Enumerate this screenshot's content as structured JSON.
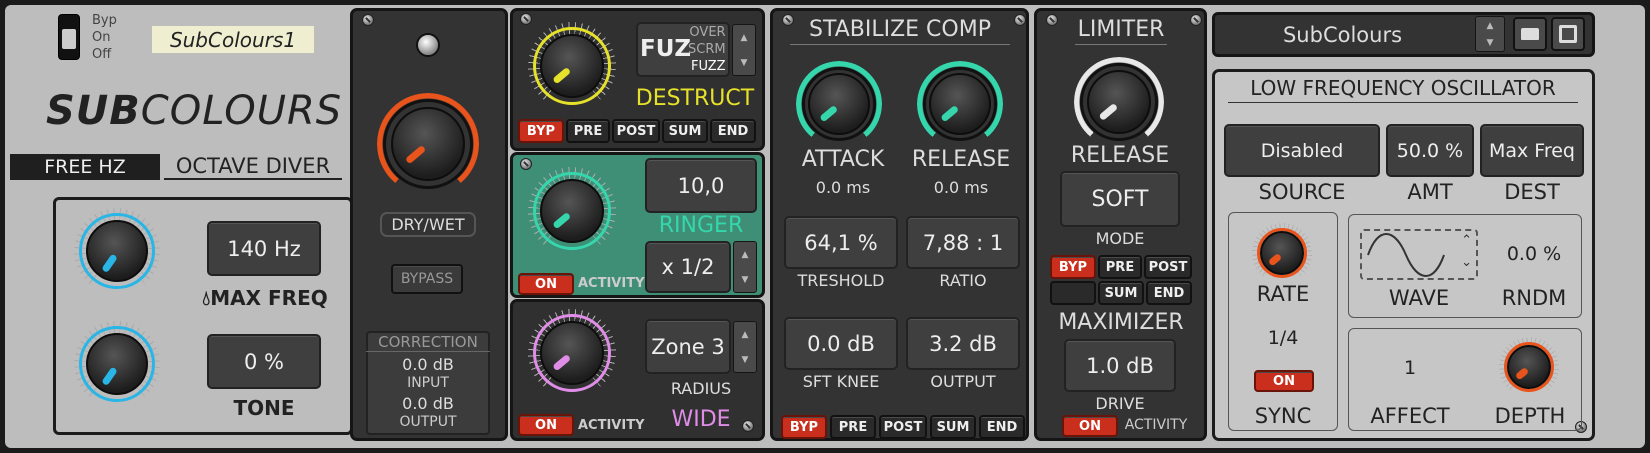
{
  "header": {
    "switch_labels": [
      "Byp",
      "On",
      "Off"
    ],
    "preset_tag": "SubColours1",
    "logo_bold": "SUB",
    "logo_light": "COLOURS",
    "mode_free": "FREE HZ",
    "mode_octave": "OCTAVE DIVER"
  },
  "lowband": {
    "max_freq_value": "140 Hz",
    "max_freq_label": "MAX FREQ",
    "tone_value": "0 %",
    "tone_label": "TONE"
  },
  "mix": {
    "drywet_label": "DRY/WET",
    "bypass_label": "BYPASS",
    "correction_title": "CORRECTION",
    "input_value": "0.0 dB",
    "input_label": "INPUT",
    "output_value": "0.0 dB",
    "output_label": "OUTPUT"
  },
  "destruct": {
    "algo_big": "FUZ",
    "algo_options": [
      "OVER",
      "SCRM",
      "FUZZ"
    ],
    "title": "DESTRUCT",
    "buttons": [
      "BYP",
      "PRE",
      "POST",
      "SUM",
      "END"
    ]
  },
  "ringer": {
    "value": "10,0",
    "title": "RINGER",
    "ratio": "x 1/2",
    "on_label": "ON",
    "activity_label": "ACTIVITY"
  },
  "wide": {
    "zone": "Zone 3",
    "radius_label": "RADIUS",
    "title": "WIDE",
    "on_label": "ON",
    "activity_label": "ACTIVITY"
  },
  "comp": {
    "title": "STABILIZE COMP",
    "attack_label": "ATTACK",
    "attack_value": "0.0 ms",
    "release_label": "RELEASE",
    "release_value": "0.0 ms",
    "threshold_value": "64,1 %",
    "threshold_label": "TRESHOLD",
    "ratio_value": "7,88 : 1",
    "ratio_label": "RATIO",
    "knee_value": "0.0 dB",
    "knee_label": "SFT KNEE",
    "output_value": "3.2 dB",
    "output_label": "OUTPUT",
    "buttons": [
      "BYP",
      "PRE",
      "POST",
      "SUM",
      "END"
    ]
  },
  "limiter": {
    "title": "LIMITER",
    "release_label": "RELEASE",
    "mode_value": "SOFT",
    "mode_label": "MODE",
    "buttons_top": [
      "BYP",
      "PRE",
      "POST"
    ],
    "buttons_bottom": [
      "SUM",
      "END"
    ],
    "max_title": "MAXIMIZER",
    "drive_value": "1.0 dB",
    "drive_label": "DRIVE",
    "on_label": "ON",
    "activity_label": "ACTIVITY"
  },
  "preset": {
    "name": "SubColours"
  },
  "lfo": {
    "title": "LOW FREQUENCY OSCILLATOR",
    "source_value": "Disabled",
    "source_label": "SOURCE",
    "amt_value": "50.0 %",
    "amt_label": "AMT",
    "dest_value": "Max Freq",
    "dest_label": "DEST",
    "rate_label": "RATE",
    "rate_value": "1/4",
    "sync_on": "ON",
    "sync_label": "SYNC",
    "wave_label": "WAVE",
    "rndm_value": "0.0 %",
    "rndm_label": "RNDM",
    "affect_value": "1",
    "affect_label": "AFFECT",
    "depth_label": "DEPTH"
  },
  "colors": {
    "orange": "#e8541c",
    "cyan": "#29b6e6",
    "yellow": "#e6e12a",
    "teal": "#36d6ad",
    "pink": "#e08de8",
    "red": "#c92f1c",
    "ringer_bg": "#3f8f77"
  }
}
